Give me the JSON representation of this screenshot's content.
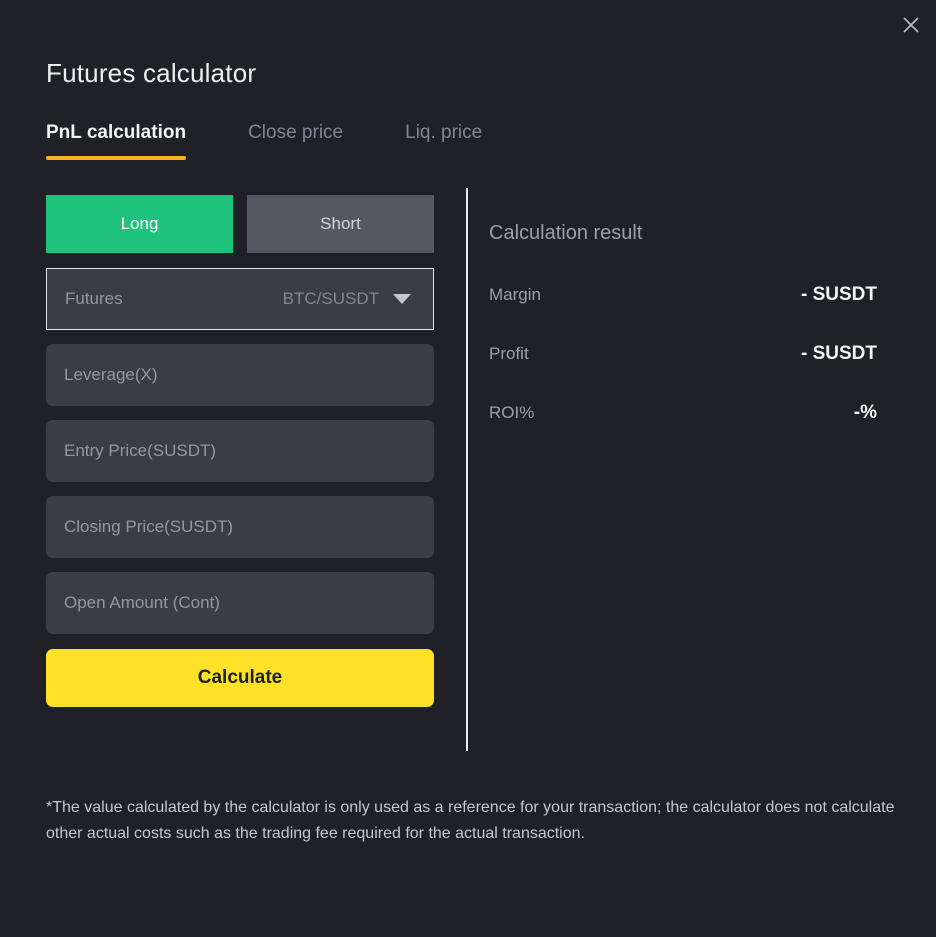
{
  "window": {
    "title": "Futures calculator",
    "close_icon": "close-icon"
  },
  "tabs": [
    {
      "label": "PnL calculation",
      "active": true
    },
    {
      "label": "Close price",
      "active": false
    },
    {
      "label": "Liq. price",
      "active": false
    }
  ],
  "form": {
    "side": {
      "long_label": "Long",
      "short_label": "Short",
      "selected": "Long"
    },
    "contract": {
      "label": "Futures",
      "value": "BTC/SUSDT",
      "caret_icon": "chevron-down-icon"
    },
    "inputs": [
      {
        "placeholder": "Leverage(X)",
        "value": ""
      },
      {
        "placeholder": "Entry Price(SUSDT)",
        "value": ""
      },
      {
        "placeholder": "Closing Price(SUSDT)",
        "value": ""
      },
      {
        "placeholder": "Open Amount  (Cont)",
        "value": ""
      }
    ],
    "submit_label": "Calculate"
  },
  "result": {
    "title": "Calculation result",
    "rows": [
      {
        "label": "Margin",
        "value": "- SUSDT"
      },
      {
        "label": "Profit",
        "value": "- SUSDT"
      },
      {
        "label": "ROI%",
        "value": "-%"
      }
    ]
  },
  "note": "*The value calculated by the calculator is only used as a reference for your transaction; the calculator does not calculate other actual costs such as the trading fee required for the actual transaction.",
  "colors": {
    "background": "#1f2127",
    "long_green": "#1fc27c",
    "short_gray": "#545863",
    "accent_yellow": "#ffe227",
    "tab_underline": "#f5b320",
    "field_bg": "#3a3d45",
    "divider": "#e8eaee"
  }
}
